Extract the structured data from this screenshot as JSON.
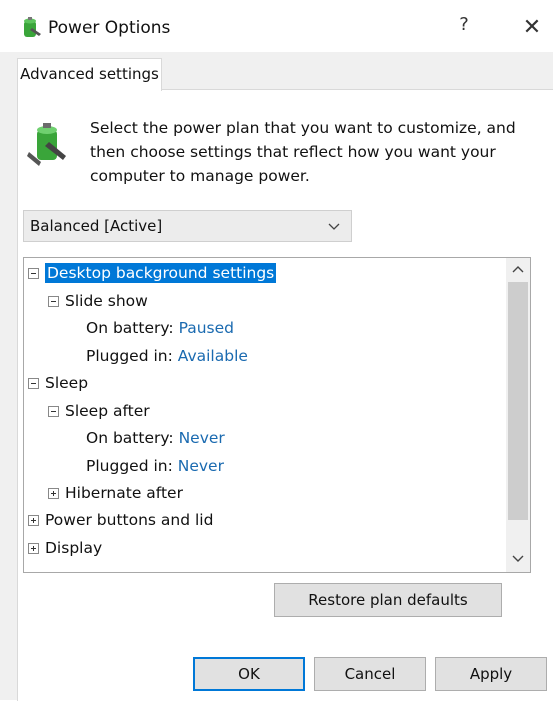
{
  "window": {
    "title": "Power Options",
    "help_glyph": "?",
    "close_glyph": "✕"
  },
  "tab": {
    "label": "Advanced settings"
  },
  "description": "Select the power plan that you want to customize, and then choose settings that reflect how you want your computer to manage power.",
  "plan_select": {
    "value": "Balanced [Active]"
  },
  "tree": {
    "items": [
      {
        "label": "Desktop background settings",
        "value": ""
      },
      {
        "label": "Slide show",
        "value": ""
      },
      {
        "label": "On battery:",
        "value": "Paused"
      },
      {
        "label": "Plugged in:",
        "value": "Available"
      },
      {
        "label": "Sleep",
        "value": ""
      },
      {
        "label": "Sleep after",
        "value": ""
      },
      {
        "label": "On battery:",
        "value": "Never"
      },
      {
        "label": "Plugged in:",
        "value": "Never"
      },
      {
        "label": "Hibernate after",
        "value": ""
      },
      {
        "label": "Power buttons and lid",
        "value": ""
      },
      {
        "label": "Display",
        "value": ""
      }
    ]
  },
  "buttons": {
    "restore": "Restore plan defaults",
    "ok": "OK",
    "cancel": "Cancel",
    "apply": "Apply"
  },
  "colors": {
    "selection": "#0078d7",
    "value_link": "#1a6ab0",
    "dialog_background": "#f0f0f0"
  },
  "icons": {
    "app": "battery-power-icon",
    "description": "battery-power-icon",
    "dropdown": "chevron-down-icon",
    "scroll_up": "chevron-up-icon",
    "scroll_down": "chevron-down-icon"
  }
}
